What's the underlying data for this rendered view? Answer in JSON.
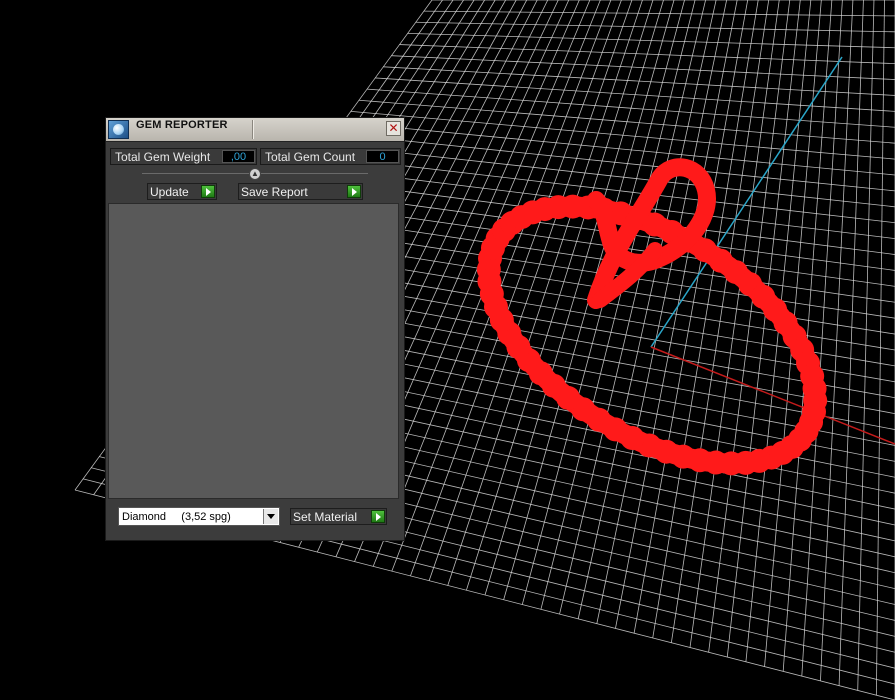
{
  "panel": {
    "title": "GEM REPORTER",
    "close_glyph": "✕",
    "stats": {
      "weight_label": "Total Gem Weight",
      "weight_value": ",00",
      "count_label": "Total Gem Count",
      "count_value": "0"
    },
    "buttons": {
      "update_label": "Update",
      "save_report_label": "Save Report",
      "set_material_label": "Set Material"
    },
    "material": {
      "selected": "Diamond     (3,52 spg)"
    }
  },
  "icons": {
    "app": "gem-reporter-icon",
    "close": "close-icon",
    "collapse": "chevron-up-icon",
    "run": "play-icon",
    "dropdown": "chevron-down-icon"
  },
  "colors": {
    "viewport_bg": "#000000",
    "grid": "#d9d9d9",
    "axis_y": "#2aa6c9",
    "axis_x": "#c41b1b",
    "model": "#ff1a1a",
    "value_text": "#2fa4d8",
    "run_button": "#3da22c"
  }
}
